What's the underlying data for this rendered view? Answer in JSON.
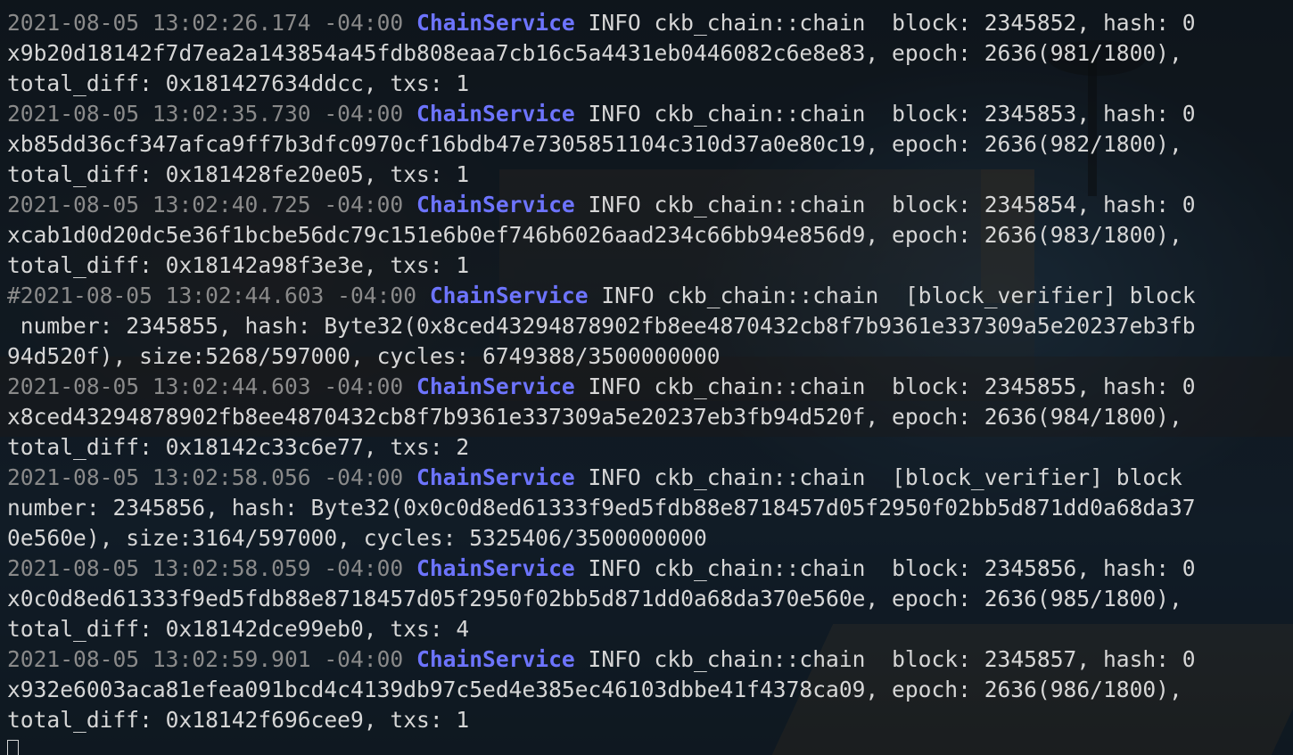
{
  "terminal": {
    "lines": [
      {
        "ts": "2021-08-05 13:02:26.174 -04:00 ",
        "svc": "ChainService",
        "msg": " INFO ckb_chain::chain  block: 2345852, hash: 0"
      },
      {
        "ts": "",
        "svc": "",
        "msg": "x9b20d18142f7d7ea2a143854a45fdb808eaa7cb16c5a4431eb0446082c6e8e83, epoch: 2636(981/1800),"
      },
      {
        "ts": "",
        "svc": "",
        "msg": "total_diff: 0x181427634ddcc, txs: 1"
      },
      {
        "ts": "2021-08-05 13:02:35.730 -04:00 ",
        "svc": "ChainService",
        "msg": " INFO ckb_chain::chain  block: 2345853, hash: 0"
      },
      {
        "ts": "",
        "svc": "",
        "msg": "xb85dd36cf347afca9ff7b3dfc0970cf16bdb47e7305851104c310d37a0e80c19, epoch: 2636(982/1800),"
      },
      {
        "ts": "",
        "svc": "",
        "msg": "total_diff: 0x181428fe20e05, txs: 1"
      },
      {
        "ts": "2021-08-05 13:02:40.725 -04:00 ",
        "svc": "ChainService",
        "msg": " INFO ckb_chain::chain  block: 2345854, hash: 0"
      },
      {
        "ts": "",
        "svc": "",
        "msg": "xcab1d0d20dc5e36f1bcbe56dc79c151e6b0ef746b6026aad234c66bb94e856d9, epoch: 2636(983/1800),"
      },
      {
        "ts": "",
        "svc": "",
        "msg": "total_diff: 0x18142a98f3e3e, txs: 1"
      },
      {
        "ts": "#2021-08-05 13:02:44.603 -04:00 ",
        "svc": "ChainService",
        "msg": " INFO ckb_chain::chain  [block_verifier] block"
      },
      {
        "ts": "",
        "svc": "",
        "msg": " number: 2345855, hash: Byte32(0x8ced43294878902fb8ee4870432cb8f7b9361e337309a5e20237eb3fb"
      },
      {
        "ts": "",
        "svc": "",
        "msg": "94d520f), size:5268/597000, cycles: 6749388/3500000000"
      },
      {
        "ts": "2021-08-05 13:02:44.603 -04:00 ",
        "svc": "ChainService",
        "msg": " INFO ckb_chain::chain  block: 2345855, hash: 0"
      },
      {
        "ts": "",
        "svc": "",
        "msg": "x8ced43294878902fb8ee4870432cb8f7b9361e337309a5e20237eb3fb94d520f, epoch: 2636(984/1800),"
      },
      {
        "ts": "",
        "svc": "",
        "msg": "total_diff: 0x18142c33c6e77, txs: 2"
      },
      {
        "ts": "2021-08-05 13:02:58.056 -04:00 ",
        "svc": "ChainService",
        "msg": " INFO ckb_chain::chain  [block_verifier] block "
      },
      {
        "ts": "",
        "svc": "",
        "msg": "number: 2345856, hash: Byte32(0x0c0d8ed61333f9ed5fdb88e8718457d05f2950f02bb5d871dd0a68da37"
      },
      {
        "ts": "",
        "svc": "",
        "msg": "0e560e), size:3164/597000, cycles: 5325406/3500000000"
      },
      {
        "ts": "2021-08-05 13:02:58.059 -04:00 ",
        "svc": "ChainService",
        "msg": " INFO ckb_chain::chain  block: 2345856, hash: 0"
      },
      {
        "ts": "",
        "svc": "",
        "msg": "x0c0d8ed61333f9ed5fdb88e8718457d05f2950f02bb5d871dd0a68da370e560e, epoch: 2636(985/1800),"
      },
      {
        "ts": "",
        "svc": "",
        "msg": "total_diff: 0x18142dce99eb0, txs: 4"
      },
      {
        "ts": "2021-08-05 13:02:59.901 -04:00 ",
        "svc": "ChainService",
        "msg": " INFO ckb_chain::chain  block: 2345857, hash: 0"
      },
      {
        "ts": "",
        "svc": "",
        "msg": "x932e6003aca81efea091bcd4c4139db97c5ed4e385ec46103dbbe41f4378ca09, epoch: 2636(986/1800),"
      },
      {
        "ts": "",
        "svc": "",
        "msg": "total_diff: 0x18142f696cee9, txs: 1"
      }
    ],
    "cursor_icon": "block-cursor",
    "colors": {
      "timestamp": "#8a8a8a",
      "service": "#6d74ff",
      "text": "#d6d6d6"
    }
  }
}
